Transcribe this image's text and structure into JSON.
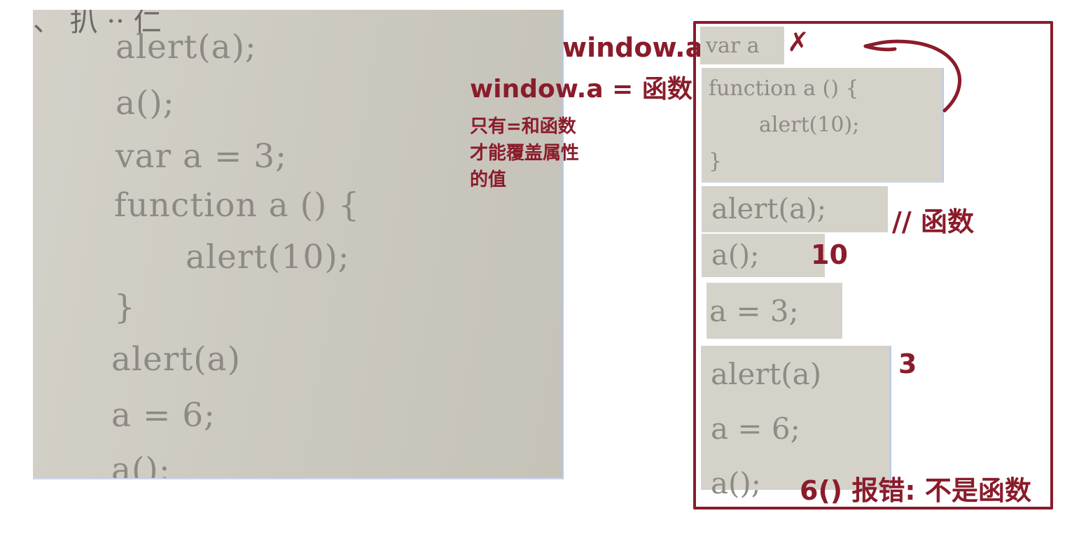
{
  "left_photo": {
    "lines": [
      "alert(a);",
      "a();",
      "var a = 3;",
      "function a () {",
      "alert(10);",
      "}",
      "alert(a)",
      "a = 6;",
      "a();"
    ]
  },
  "right_snippets": {
    "var_a": "var a",
    "func_line1": "function a () {",
    "func_line2": "alert(10);",
    "func_line3": "}",
    "alert_a_1": "alert(a);",
    "call_a_1": "a();",
    "assign_3": "a = 3;",
    "alert_a_2": "alert(a)",
    "assign_6": "a = 6;",
    "call_a_2": "a();"
  },
  "annotations": {
    "window_a": "window.a",
    "window_a_func": "window.a = 函数",
    "note_lines": [
      "只有=和函数",
      "才能覆盖属性",
      "的值"
    ],
    "cross_mark": "✗",
    "comment_func": "// 函数",
    "result_10": "10",
    "result_3": "3",
    "result_error": "6() 报错: 不是函数"
  },
  "colors": {
    "annotation_red": "#8a1c2b",
    "paper": "#d3d0c7",
    "print": "#8e8b84",
    "photo_border": "#b9c9e6"
  }
}
